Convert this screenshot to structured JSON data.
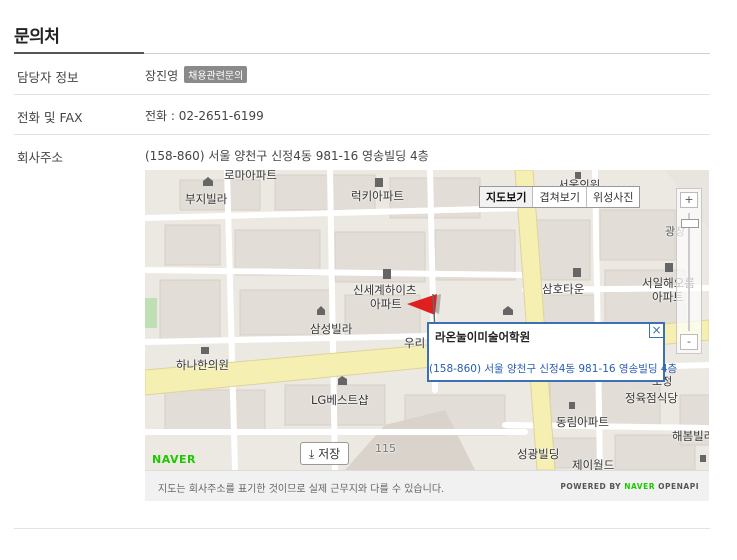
{
  "section": {
    "title": "문의처"
  },
  "rows": {
    "manager": {
      "label": "담당자 정보",
      "value": "장진영",
      "badge": "채용관련문의"
    },
    "phone": {
      "label": "전화 및 FAX",
      "value": "전화 : 02-2651-6199"
    },
    "address": {
      "label": "회사주소",
      "value": "(158-860) 서울 양천구 신정4동 981-16 영송빌딩 4층"
    }
  },
  "map": {
    "type_buttons": [
      "지도보기",
      "겹쳐보기",
      "위성사진"
    ],
    "zoom_in": "+",
    "zoom_out": "-",
    "info_window": {
      "name": "라온눌이미술어학원",
      "address": "(158-860) 서울 양천구 신정4동 981-16 영송빌딩 4층",
      "close": "×"
    },
    "save_label": "저장",
    "logo": "NAVER",
    "labels": {
      "romaapt": "로마아파트",
      "buji": "부지빌라",
      "lucky": "럭키아파트",
      "seouleuihyeon": "서울의원",
      "shinsegae1": "신세계하이츠",
      "shinsegae2": "아파트",
      "samhotown": "삼호타운",
      "seoilhae1": "서일해오름",
      "seoilhae2": "아파트",
      "samsung": "삼성빌라",
      "hanahan": "하나한의원",
      "woori": "우리",
      "lgbest": "LG베스트샵",
      "jungyuk": "정육점식당",
      "donglim": "동림아파트",
      "haebom": "해봄빌라",
      "seonggwang": "성광빌딩",
      "jeiworld": "제이월드",
      "num115": "115",
      "gwangjang": "광장",
      "ojeong": "오정"
    },
    "footer_note": "지도는 회사주소를 표기한 것이므로 실제 근무지와 다를 수 있습니다.",
    "powered_prefix": "POWERED BY",
    "powered_brand": "NAVER",
    "powered_suffix": "OPENAPI"
  },
  "colors": {
    "accent": "#3d6fb6",
    "naver_green": "#1ec800",
    "road": "#f7f0b0",
    "block": "#e4e0da"
  }
}
